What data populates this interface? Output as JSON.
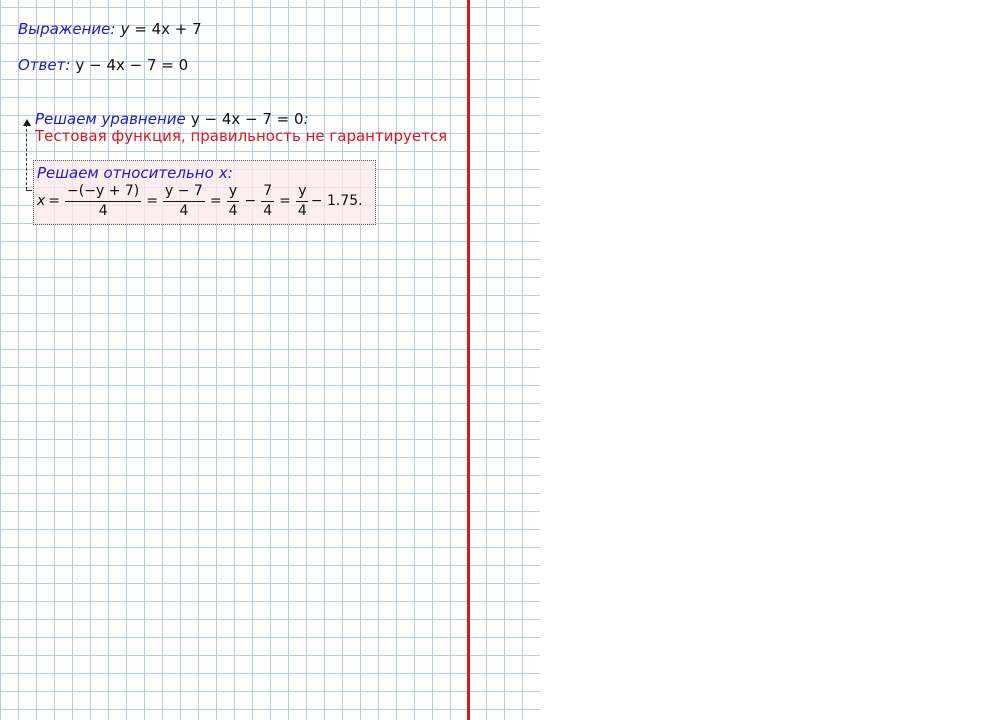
{
  "expression": {
    "label": "Выражение:",
    "lhs": "y",
    "eq": "=",
    "rhs": "4x + 7"
  },
  "answer": {
    "label": "Ответ:",
    "value": "y − 4x − 7 = 0"
  },
  "solve": {
    "label": "Решаем уравнение",
    "equation": "y − 4x − 7 = 0",
    "colon": ":",
    "warning": "Тестовая функция, правильность не гарантируется"
  },
  "solution": {
    "label": "Решаем относительно",
    "var": "x",
    "colon": ":",
    "lhs": "x",
    "eq": "=",
    "frac1_num_open": "−(",
    "frac1_num_mid": "−y + 7",
    "frac1_num_close": ")",
    "frac1_den": "4",
    "frac2_num": "y − 7",
    "frac2_den": "4",
    "frac3_num": "y",
    "frac3_den": "4",
    "minus": "−",
    "frac4_num": "7",
    "frac4_den": "4",
    "frac5_num": "y",
    "frac5_den": "4",
    "tail": "− 1.75."
  },
  "colors": {
    "label_blue": "#1a1ad0",
    "warning_red": "#e0161c",
    "grid_line": "#b8cde8",
    "margin_line": "#e0161c",
    "box_fill": "#fde8e8"
  }
}
